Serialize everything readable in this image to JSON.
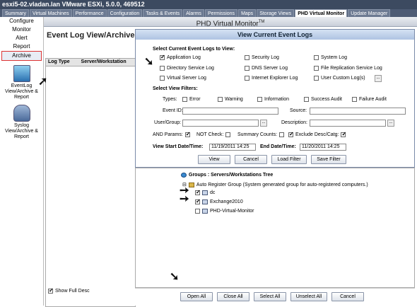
{
  "window": {
    "title": "esxi5-02.vladan.lan VMware ESXi, 5.0.0, 469512"
  },
  "tabs": [
    "Summary",
    "Virtual Machines",
    "Performance",
    "Configuration",
    "Tasks & Events",
    "Alarms",
    "Permissions",
    "Maps",
    "Storage Views",
    "PHD Virtual Monitor",
    "Update Manager"
  ],
  "app": {
    "title": "PHD Virtual Monitor",
    "tm": "TM"
  },
  "nav": {
    "configure": "Configure",
    "monitor": "Monitor",
    "alert": "Alert",
    "report": "Report",
    "archive": "Archive",
    "eventlog": "EventLog View/Archive & Report",
    "syslog": "Syslog View/Archive & Report"
  },
  "background": {
    "title": "Event Log View/Archive &",
    "col_logtype": "Log Type",
    "col_server": "Server/Workstation",
    "show_full_desc": "Show Full Desc"
  },
  "dialog": {
    "title": "View Current Event Logs",
    "select_logs_label": "Select Current Event Logs to View:",
    "logs": {
      "application": "Application Log",
      "security": "Security Log",
      "system": "System Log",
      "directory": "Directory Service Log",
      "dns": "DNS Server Log",
      "file_replication": "File Replication Service Log",
      "virtual_server": "Virtual Server Log",
      "ie": "Internet Explorer Log",
      "custom": "User Custom Log(s)"
    },
    "filters_label": "Select View Filters:",
    "types_label": "Types:",
    "types": {
      "error": "Error",
      "warning": "Warning",
      "information": "Information",
      "success_audit": "Success Audit",
      "failure_audit": "Failure Audit"
    },
    "event_id_label": "Event ID:",
    "source_label": "Source:",
    "user_group_label": "User/Group:",
    "description_label": "Description:",
    "dots": "...",
    "and_params": "AND Params:",
    "not_check": "NOT Check:",
    "summary_counts": "Summary Counts:",
    "exclude_desc": "Exclude Desc/Catg:",
    "start_label": "View Start Date/Time:",
    "start_value": "11/19/2011 14:25",
    "end_label": "End Date/Time:",
    "end_value": "11/20/2011 14:25",
    "buttons": {
      "view": "View",
      "cancel": "Cancel",
      "load_filter": "Load Filter",
      "save_filter": "Save Filter"
    }
  },
  "tree": {
    "root": "Groups : Servers/Workstations Tree",
    "group": "Auto Register Group (System generated group for auto-registered computers.)",
    "items": [
      "dc",
      "Exchange2010",
      "PHD-Virtual-Monitor"
    ]
  },
  "bottom_buttons": {
    "open_all": "Open All",
    "close_all": "Close All",
    "select_all": "Select All",
    "unselect_all": "Unselect All",
    "cancel": "Cancel"
  }
}
